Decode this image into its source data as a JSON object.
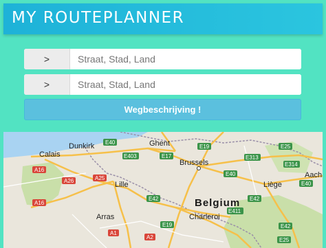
{
  "header": {
    "title": "MY ROUTEPLANNER"
  },
  "form": {
    "from": {
      "addon": ">",
      "placeholder": "Straat, Stad, Land",
      "value": ""
    },
    "to": {
      "addon": ">",
      "placeholder": "Straat, Stad, Land",
      "value": ""
    },
    "submit_label": "Wegbeschrijving !"
  },
  "map": {
    "cities": {
      "calais": "Calais",
      "dunkirk": "Dunkirk",
      "ghent": "Ghent",
      "brussels": "Brussels",
      "lille": "Lille",
      "arras": "Arras",
      "charleroi": "Charleroi",
      "liege": "Liège",
      "aach": "Aach"
    },
    "country": "Belgium",
    "roads": {
      "e40_a": "E40",
      "e403": "E403",
      "e17": "E17",
      "e19": "E19",
      "e313": "E313",
      "e25": "E25",
      "e314": "E314",
      "e40_b": "E40",
      "e40_c": "E40",
      "e42_a": "E42",
      "e42_b": "E42",
      "e411": "E411",
      "e19_b": "E19",
      "e42_c": "E42",
      "e25_b": "E25",
      "a16_a": "A16",
      "a26": "A26",
      "a25": "A25",
      "a16_b": "A16",
      "a1": "A1",
      "a2": "A2"
    },
    "colors": {
      "sea": "#a9d3f2",
      "land": "#eae6dc",
      "green": "#c9dfa9",
      "motorway": "#f6c04a",
      "border": "#9a8fa8"
    }
  }
}
